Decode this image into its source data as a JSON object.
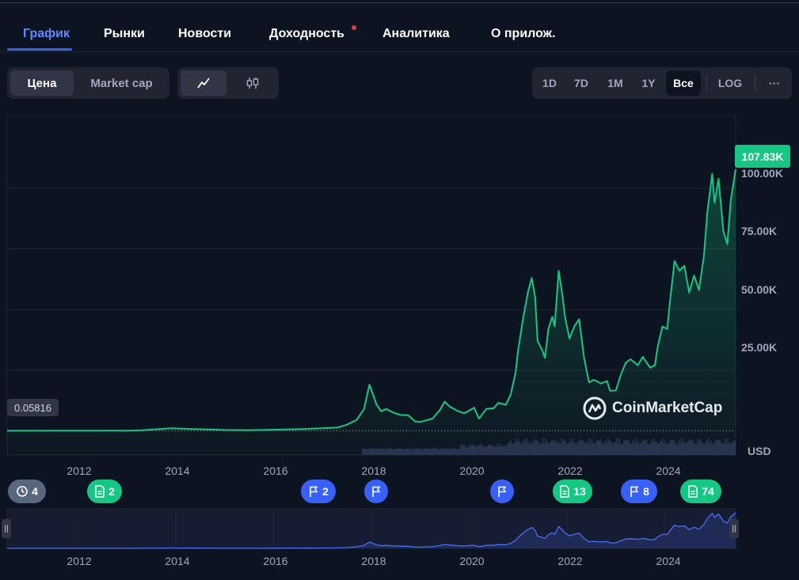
{
  "tabs": [
    {
      "label": "График",
      "active": true
    },
    {
      "label": "Рынки",
      "active": false
    },
    {
      "label": "Новости",
      "active": false
    },
    {
      "label": "Доходность",
      "active": false,
      "dot": true
    },
    {
      "label": "Аналитика",
      "active": false
    },
    {
      "label": "О прилож.",
      "active": false
    }
  ],
  "toolbar": {
    "mode_price": "Цена",
    "mode_mcap": "Market cap",
    "line_icon": "line-chart-icon",
    "candle_icon": "candlestick-icon",
    "ranges": [
      "1D",
      "7D",
      "1M",
      "1Y",
      "Все"
    ],
    "active_range": "Все",
    "log_label": "LOG",
    "more_label": "···"
  },
  "colors": {
    "background": "#0d1421",
    "accent": "#3861fb",
    "up_green": "#16c784",
    "navigator_line": "#4a6cf7"
  },
  "chart_data": {
    "type": "area",
    "title": "",
    "xlabel": "",
    "ylabel": "USD",
    "ylim": [
      -10000,
      130000
    ],
    "y_ticks": [
      25000,
      50000,
      75000,
      100000
    ],
    "y_tick_labels": [
      "25.00K",
      "50.00K",
      "75.00K",
      "100.00K"
    ],
    "x_ticks": [
      2012,
      2014,
      2016,
      2018,
      2020,
      2022,
      2024
    ],
    "x_range": [
      2010.55,
      2025.45
    ],
    "current_price_label": "107.83K",
    "start_price_label": "0.05816",
    "grid": true,
    "series": [
      {
        "values": [
          [
            2010.55,
            0.06
          ],
          [
            2011.5,
            5
          ],
          [
            2012.5,
            10
          ],
          [
            2013.0,
            20
          ],
          [
            2013.3,
            200
          ],
          [
            2013.9,
            1000
          ],
          [
            2014.5,
            600
          ],
          [
            2015.0,
            300
          ],
          [
            2015.5,
            250
          ],
          [
            2016.0,
            400
          ],
          [
            2016.5,
            650
          ],
          [
            2017.0,
            1000
          ],
          [
            2017.3,
            1300
          ],
          [
            2017.5,
            2500
          ],
          [
            2017.7,
            4500
          ],
          [
            2017.85,
            9000
          ],
          [
            2017.96,
            19000
          ],
          [
            2018.05,
            14000
          ],
          [
            2018.1,
            11000
          ],
          [
            2018.2,
            8000
          ],
          [
            2018.3,
            9000
          ],
          [
            2018.45,
            7500
          ],
          [
            2018.6,
            6500
          ],
          [
            2018.75,
            6400
          ],
          [
            2018.9,
            3800
          ],
          [
            2019.0,
            3600
          ],
          [
            2019.25,
            5000
          ],
          [
            2019.4,
            8500
          ],
          [
            2019.5,
            12000
          ],
          [
            2019.6,
            10000
          ],
          [
            2019.75,
            8300
          ],
          [
            2019.9,
            7200
          ],
          [
            2020.1,
            9500
          ],
          [
            2020.2,
            5000
          ],
          [
            2020.35,
            9000
          ],
          [
            2020.5,
            9300
          ],
          [
            2020.6,
            11500
          ],
          [
            2020.75,
            10700
          ],
          [
            2020.85,
            15000
          ],
          [
            2020.95,
            24000
          ],
          [
            2021.0,
            33000
          ],
          [
            2021.1,
            46000
          ],
          [
            2021.2,
            57000
          ],
          [
            2021.28,
            63000
          ],
          [
            2021.35,
            55000
          ],
          [
            2021.4,
            37000
          ],
          [
            2021.5,
            33000
          ],
          [
            2021.55,
            30000
          ],
          [
            2021.62,
            42000
          ],
          [
            2021.7,
            47000
          ],
          [
            2021.75,
            43000
          ],
          [
            2021.83,
            66000
          ],
          [
            2021.9,
            57000
          ],
          [
            2021.96,
            47000
          ],
          [
            2022.05,
            38000
          ],
          [
            2022.15,
            43000
          ],
          [
            2022.25,
            46000
          ],
          [
            2022.35,
            30000
          ],
          [
            2022.45,
            20000
          ],
          [
            2022.55,
            21000
          ],
          [
            2022.7,
            19500
          ],
          [
            2022.82,
            20500
          ],
          [
            2022.88,
            16500
          ],
          [
            2023.0,
            16600
          ],
          [
            2023.1,
            23000
          ],
          [
            2023.2,
            28000
          ],
          [
            2023.3,
            29500
          ],
          [
            2023.45,
            27000
          ],
          [
            2023.55,
            30500
          ],
          [
            2023.7,
            26000
          ],
          [
            2023.8,
            27000
          ],
          [
            2023.85,
            34000
          ],
          [
            2023.95,
            43000
          ],
          [
            2024.05,
            42000
          ],
          [
            2024.1,
            52000
          ],
          [
            2024.2,
            70000
          ],
          [
            2024.3,
            66000
          ],
          [
            2024.4,
            68000
          ],
          [
            2024.5,
            57000
          ],
          [
            2024.6,
            64000
          ],
          [
            2024.7,
            58000
          ],
          [
            2024.8,
            72000
          ],
          [
            2024.87,
            90000
          ],
          [
            2024.92,
            98000
          ],
          [
            2024.97,
            106000
          ],
          [
            2025.02,
            94000
          ],
          [
            2025.1,
            104000
          ],
          [
            2025.2,
            82000
          ],
          [
            2025.28,
            77000
          ],
          [
            2025.35,
            95000
          ],
          [
            2025.45,
            107830
          ]
        ]
      }
    ]
  },
  "events": [
    {
      "type": "history",
      "icon": "history-icon",
      "count": "4"
    },
    {
      "type": "news",
      "icon": "document-icon",
      "count": "2"
    },
    {
      "type": "flag",
      "icon": "flag-icon",
      "count": "2"
    },
    {
      "type": "flag",
      "icon": "flag-icon",
      "count": ""
    },
    {
      "type": "flag",
      "icon": "flag-icon",
      "count": ""
    },
    {
      "type": "news",
      "icon": "document-icon",
      "count": "13"
    },
    {
      "type": "flag",
      "icon": "flag-icon",
      "count": "8"
    },
    {
      "type": "news",
      "icon": "document-icon",
      "count": "74"
    }
  ],
  "watermark": "CoinMarketCap",
  "navigator": {
    "handle_glyph": "||"
  }
}
